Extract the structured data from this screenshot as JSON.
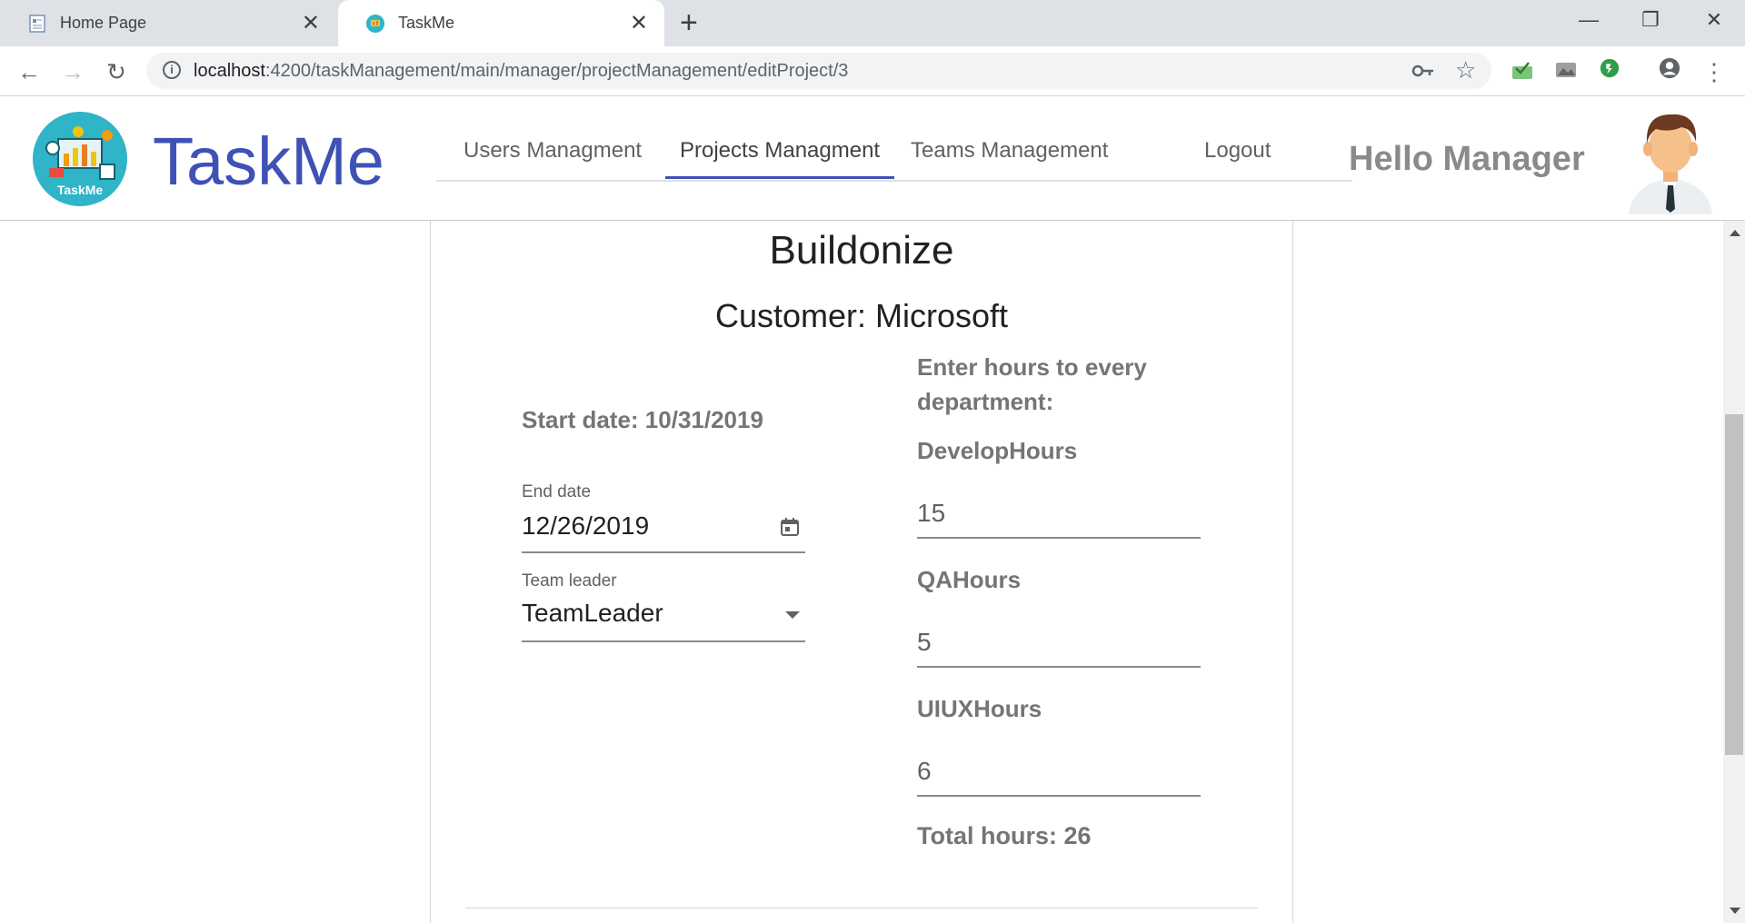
{
  "browser": {
    "tabs": [
      {
        "label": "Home Page",
        "active": false
      },
      {
        "label": "TaskMe",
        "active": true
      }
    ],
    "new_tab_symbol": "+",
    "close_symbol": "✕",
    "url_host": "localhost",
    "url_path": ":4200/taskManagement/main/manager/projectManagement/editProject/3",
    "back_symbol": "←",
    "forward_symbol": "→",
    "reload_symbol": "↻",
    "minimize_symbol": "—",
    "restore_symbol": "❐",
    "window_close_symbol": "✕",
    "key_icon": "key-icon",
    "star_symbol": "☆",
    "menu_symbol": "⋮",
    "info_symbol": "i"
  },
  "app": {
    "brand": "TaskMe",
    "logo_label": "TaskMe",
    "nav": [
      {
        "label": "Users Managment",
        "active": false
      },
      {
        "label": "Projects Managment",
        "active": true
      },
      {
        "label": "Teams Management",
        "active": false
      },
      {
        "label": "Logout",
        "active": false
      }
    ],
    "greeting": "Hello Manager",
    "accent_color": "#3f51b5"
  },
  "project": {
    "title": "Buildonize",
    "customer": "Customer: Microsoft",
    "start_date": "Start date: 10/31/2019",
    "end_date_label": "End date",
    "end_date_value": "12/26/2019",
    "team_leader_label": "Team leader",
    "team_leader_value": "TeamLeader",
    "hours_heading": "Enter hours to every department:",
    "departments": [
      {
        "label": "DevelopHours",
        "value": "15"
      },
      {
        "label": "QAHours",
        "value": "5"
      },
      {
        "label": "UIUXHours",
        "value": "6"
      }
    ],
    "total": "Total hours: 26"
  }
}
